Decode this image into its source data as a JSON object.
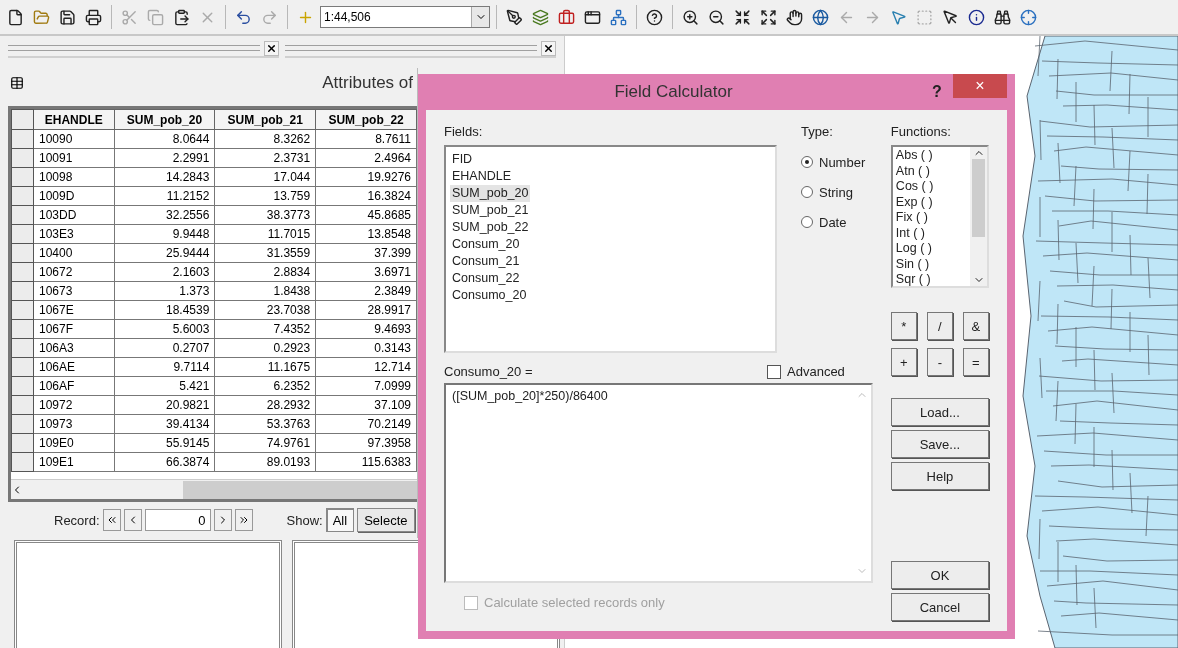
{
  "toolbar": {
    "scale": "1:44,506"
  },
  "attributes": {
    "title": "Attributes of",
    "columns": [
      "EHANDLE",
      "SUM_pob_20",
      "SUM_pob_21",
      "SUM_pob_22"
    ],
    "rows": [
      [
        "10090",
        "8.0644",
        "8.3262",
        "8.7611"
      ],
      [
        "10091",
        "2.2991",
        "2.3731",
        "2.4964"
      ],
      [
        "10098",
        "14.2843",
        "17.044",
        "19.9276"
      ],
      [
        "1009D",
        "11.2152",
        "13.759",
        "16.3824"
      ],
      [
        "103DD",
        "32.2556",
        "38.3773",
        "45.8685"
      ],
      [
        "103E3",
        "9.9448",
        "11.7015",
        "13.8548"
      ],
      [
        "10400",
        "25.9444",
        "31.3559",
        "37.399"
      ],
      [
        "10672",
        "2.1603",
        "2.8834",
        "3.6971"
      ],
      [
        "10673",
        "1.373",
        "1.8438",
        "2.3849"
      ],
      [
        "1067E",
        "18.4539",
        "23.7038",
        "28.9917"
      ],
      [
        "1067F",
        "5.6003",
        "7.4352",
        "9.4693"
      ],
      [
        "106A3",
        "0.2707",
        "0.2923",
        "0.3143"
      ],
      [
        "106AE",
        "9.7114",
        "11.1675",
        "12.714"
      ],
      [
        "106AF",
        "5.421",
        "6.2352",
        "7.0999"
      ],
      [
        "10972",
        "20.9821",
        "28.2932",
        "37.109"
      ],
      [
        "10973",
        "39.4134",
        "53.3763",
        "70.2149"
      ],
      [
        "109E0",
        "55.9145",
        "74.9761",
        "97.3958"
      ],
      [
        "109E1",
        "66.3874",
        "89.0193",
        "115.6383"
      ]
    ],
    "record_label": "Record:",
    "record_value": "0",
    "show_label": "Show:",
    "show_buttons": [
      {
        "label": "All",
        "selected": true
      },
      {
        "label": "Selecte",
        "selected": false
      }
    ]
  },
  "dialog": {
    "title": "Field Calculator",
    "help": "?",
    "close": "×",
    "fields_label": "Fields:",
    "fields": [
      {
        "label": "FID",
        "selected": false
      },
      {
        "label": "EHANDLE",
        "selected": false
      },
      {
        "label": "SUM_pob_20",
        "selected": true
      },
      {
        "label": "SUM_pob_21",
        "selected": false
      },
      {
        "label": "SUM_pob_22",
        "selected": false
      },
      {
        "label": "Consum_20",
        "selected": false
      },
      {
        "label": "Consum_21",
        "selected": false
      },
      {
        "label": "Consum_22",
        "selected": false
      },
      {
        "label": "Consumo_20",
        "selected": false
      }
    ],
    "type_label": "Type:",
    "types": [
      {
        "label": "Number",
        "selected": true
      },
      {
        "label": "String",
        "selected": false
      },
      {
        "label": "Date",
        "selected": false
      }
    ],
    "functions_label": "Functions:",
    "functions": [
      "Abs ( )",
      "Atn ( )",
      "Cos ( )",
      "Exp ( )",
      "Fix ( )",
      "Int ( )",
      "Log ( )",
      "Sin ( )",
      "Sqr ( )"
    ],
    "operators": [
      "*",
      "/",
      "&",
      "+",
      "-",
      "="
    ],
    "expression_label": "Consumo_20 =",
    "advanced": {
      "label": "Advanced",
      "checked": false
    },
    "expression": "([SUM_pob_20]*250)/86400",
    "side_buttons": [
      "Load...",
      "Save...",
      "Help"
    ],
    "selected_only": {
      "label": "Calculate selected records only",
      "checked": false,
      "disabled": true
    },
    "ok": "OK",
    "cancel": "Cancel"
  }
}
